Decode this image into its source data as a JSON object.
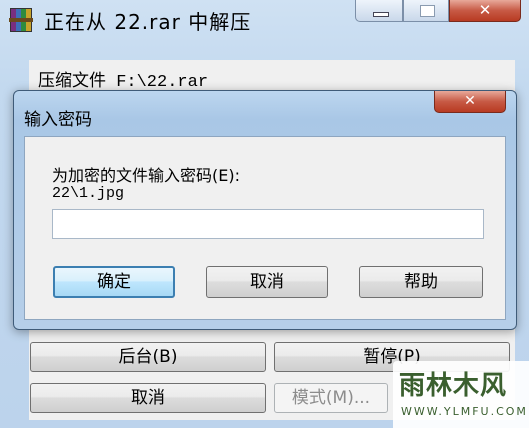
{
  "window": {
    "title": "正在从 22.rar 中解压",
    "archive_label": "压缩文件 F:\\22.rar",
    "close_glyph": "✕"
  },
  "buttons": {
    "background": "后台(B)",
    "pause": "暂停(P)",
    "cancel": "取消",
    "mode": "模式(M)..."
  },
  "dialog": {
    "title": "输入密码",
    "close_glyph": "✕",
    "prompt": "为加密的文件输入密码(E):",
    "filename": "22\\1.jpg",
    "password_value": "",
    "ok": "确定",
    "cancel": "取消",
    "help": "帮助"
  },
  "watermark": {
    "main": "雨林木风",
    "sub": "WWW.YLMFU.COM"
  },
  "colors": {
    "titlebar": "#c3d9ef",
    "close_button": "#c75a45",
    "default_button_border": "#3c7fb1"
  }
}
